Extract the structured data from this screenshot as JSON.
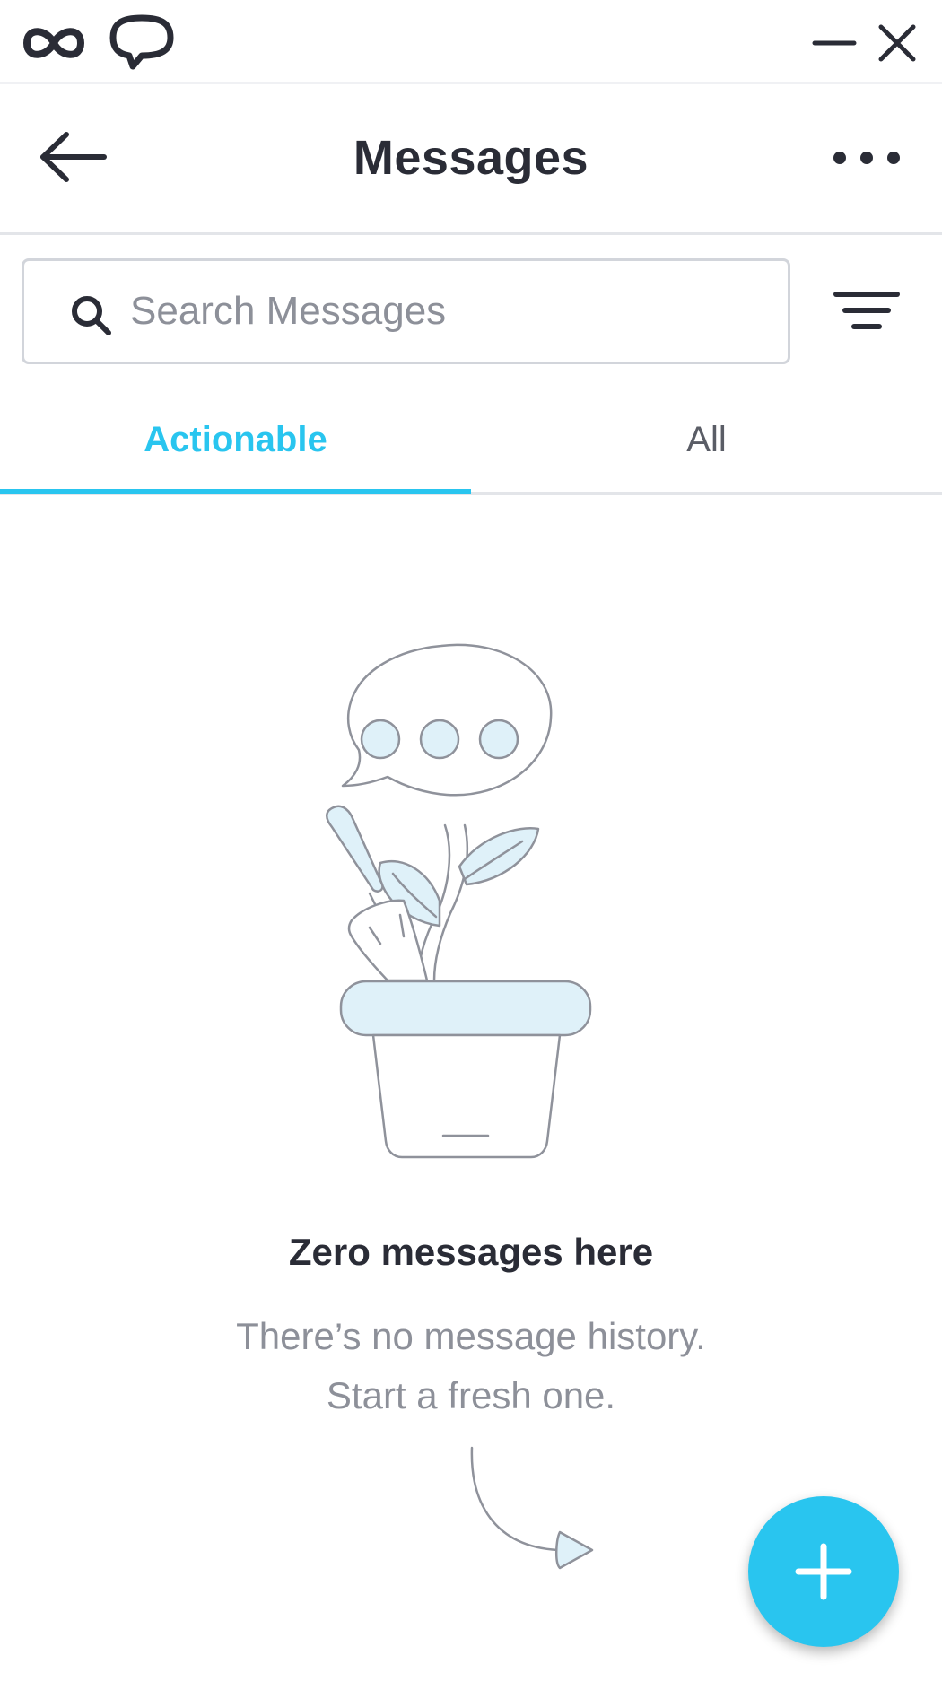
{
  "titlebar": {
    "logo_icon": "loop-logo-icon",
    "chat_icon": "chat-bubble-icon",
    "minimize_icon": "minimize-icon",
    "close_icon": "close-icon"
  },
  "header": {
    "title": "Messages",
    "back_icon": "arrow-left-icon",
    "more_icon": "more-horizontal-icon"
  },
  "search": {
    "placeholder": "Search Messages",
    "value": "",
    "icon": "search-icon",
    "filter_icon": "filter-icon"
  },
  "tabs": [
    {
      "label": "Actionable",
      "active": true
    },
    {
      "label": "All",
      "active": false
    }
  ],
  "empty_state": {
    "illustration": "plant-speech-bubble-illustration",
    "title": "Zero messages here",
    "line1": "There’s no message history.",
    "line2": "Start a fresh one."
  },
  "fab": {
    "icon": "plus-icon"
  },
  "colors": {
    "accent": "#29c5ef",
    "text_primary": "#2a2c36",
    "text_secondary": "#8d9099",
    "illustration_fill": "#dff1f9",
    "illustration_stroke": "#8f929b"
  }
}
